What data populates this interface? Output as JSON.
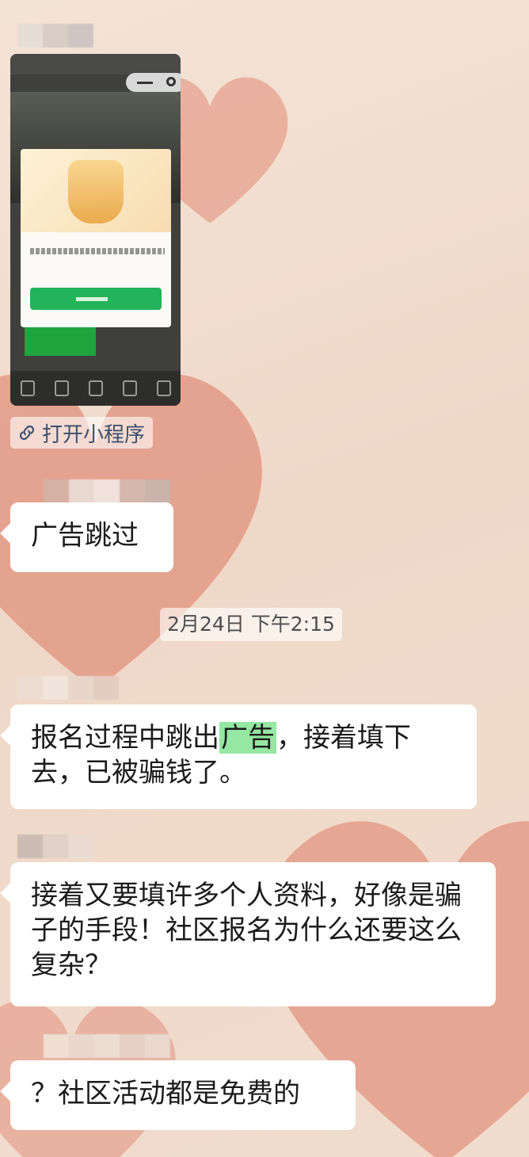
{
  "chat": {
    "mini_program": {
      "open_label": "打开小程序"
    },
    "messages": [
      {
        "text": "广告跳过"
      },
      {
        "text_before": "报名过程中跳出",
        "highlight": "广告",
        "text_after": "，接着填下去，已被骗钱了。"
      },
      {
        "text": "接着又要填许多个人资料，好像是骗子的手段！社区报名为什么还要这么复杂？"
      },
      {
        "text": "？社区活动都是免费的"
      }
    ],
    "timestamp": "2月24日 下午2:15"
  },
  "colors": {
    "bubble": "#ffffff",
    "highlight": "#95e7a2",
    "wallpaper": "#f1dccd",
    "heart": "#e8a08c",
    "link": "#3d4f6c"
  },
  "icons": {
    "open_mini_program": "link-icon",
    "blurred_names": "blurred-avatar-name"
  }
}
